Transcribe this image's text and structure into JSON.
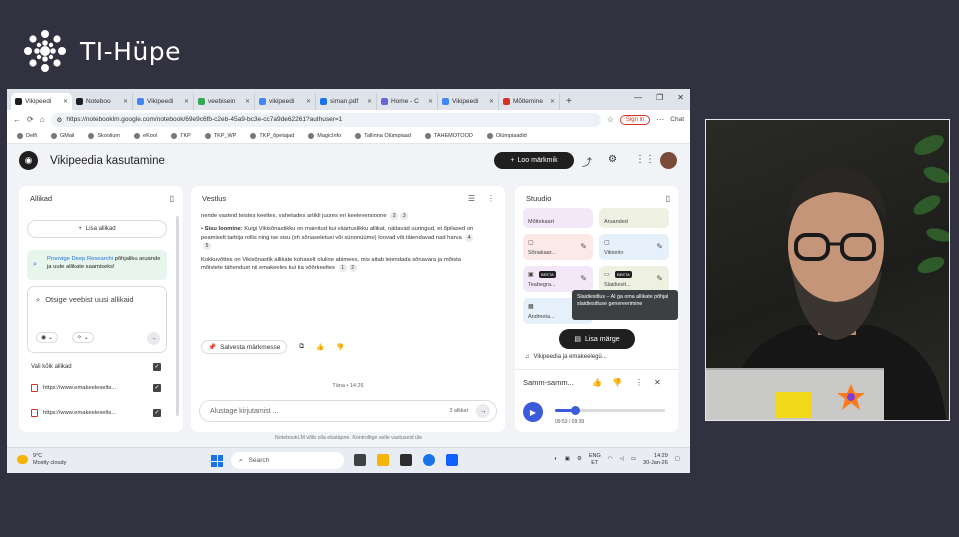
{
  "brand": {
    "name": "TI-Hüpe"
  },
  "browser": {
    "tabs": [
      {
        "label": "Vikipeedi",
        "color": "#1f1f1f",
        "active": true
      },
      {
        "label": "Noteboo",
        "color": "#1f1f1f"
      },
      {
        "label": "Vikipeedi",
        "color": "#4285f4"
      },
      {
        "label": "veebisein",
        "color": "#34a853"
      },
      {
        "label": "vikipeedi",
        "color": "#4285f4"
      },
      {
        "label": "siman.pdf",
        "color": "#1a73e8"
      },
      {
        "label": "Home - C",
        "color": "#6b63d6"
      },
      {
        "label": "Vikipeedi",
        "color": "#4285f4"
      },
      {
        "label": "Mõtlemine",
        "color": "#d93025"
      }
    ],
    "url": "https://notebooklm.google.com/notebook/69e9c6fb-c2eb-45a9-bc3e-cc7a9de62261?authuser=1",
    "signin": "Sign in",
    "chat": "Chat",
    "bookmarks": [
      "Delfi",
      "GMail",
      "Skoolium",
      "eKool",
      "TKP",
      "TKP_WP",
      "TKP_õpetajad",
      "MagicInfo",
      "Tallinna Olümpiaad",
      "TAHEMOTOOD",
      "Olümpiaadid"
    ]
  },
  "notebook": {
    "title": "Vikipeedia kasutamine",
    "new_note": "Loo märkmik"
  },
  "sources": {
    "title": "Allikad",
    "add": "Lisa allikad",
    "deep_research_pre": "Proovige Deep Researchi",
    "deep_research_post": " põhjaliku aruande ja uute allikate saamiseks!",
    "search_placeholder": "Otsige veebist uusi allikaid",
    "select_all": "Vali kõik allikad",
    "items": [
      "https://www.emakeeleselts...",
      "https://www.emakeeleselts..."
    ]
  },
  "chat": {
    "title": "Vestlus",
    "para0": "nende vasteid teistes keeltes, vahetades artikli juures eri keeleversioone",
    "para0_cites": [
      "2",
      "3"
    ],
    "para1_bold": "Sisu loomine:",
    "para1": " Kuigi Vikisõnastikku on mainitud kui väärtuslikku allikat, näitavad uuringud, et õpilased on peamiselt tarbija rollis ning ise sisu (sh sõnaseletusi või sünonüüme) loovad või täiendavad nad harva",
    "para1_cites": [
      "4",
      "5"
    ],
    "para2": "Kokkuvõttes on Vikisõnastik allikate kohaselt oluline abimees, mis aitab leiendada sõnavara ja mõista mõistete tähendust nii emakeeles kui ka võõrkeeltes",
    "para2_cites": [
      "1",
      "2"
    ],
    "save_note": "Salvesta märkmesse",
    "timestamp": "Täna • 14:26",
    "input_placeholder": "Alustage kirjutamist ...",
    "source_count": "3 allikat"
  },
  "studio": {
    "title": "Stuudio",
    "cards": [
      {
        "label": "Mõttekaart",
        "color": "#f3e8f7"
      },
      {
        "label": "Aruanded",
        "color": "#eef1e1"
      },
      {
        "label": "Sõnakaar...",
        "color": "#fbe9e7"
      },
      {
        "label": "Viktoriin",
        "color": "#e6f0fb"
      },
      {
        "label": "Teabegra...",
        "color": "#f3e8f7"
      },
      {
        "label": "Slaidiesit...",
        "color": "#eef1e1"
      },
      {
        "label": "Andmeta...",
        "color": "#e6f0fb"
      }
    ],
    "beta": "BEETA",
    "tooltip": "Slaidiesitlus – AI ga oma allikate põhjal slaidiesitluse genereerimine",
    "add_note": "Lisa märge",
    "row_label": "Vikipeedia ja emakeelegü...",
    "player_title": "Samm-samm...",
    "time": "09:53 / 09:39",
    "progress": 0.18
  },
  "footer": "NotebookLM võib olla ebatäpne. Kontrollige selle vastuseid üle",
  "taskbar": {
    "temp": "9°C",
    "weather": "Mostly cloudy",
    "search": "Search",
    "lang1": "ENG",
    "lang2": "ET",
    "time": "14:29",
    "date": "30-Jan-26"
  }
}
